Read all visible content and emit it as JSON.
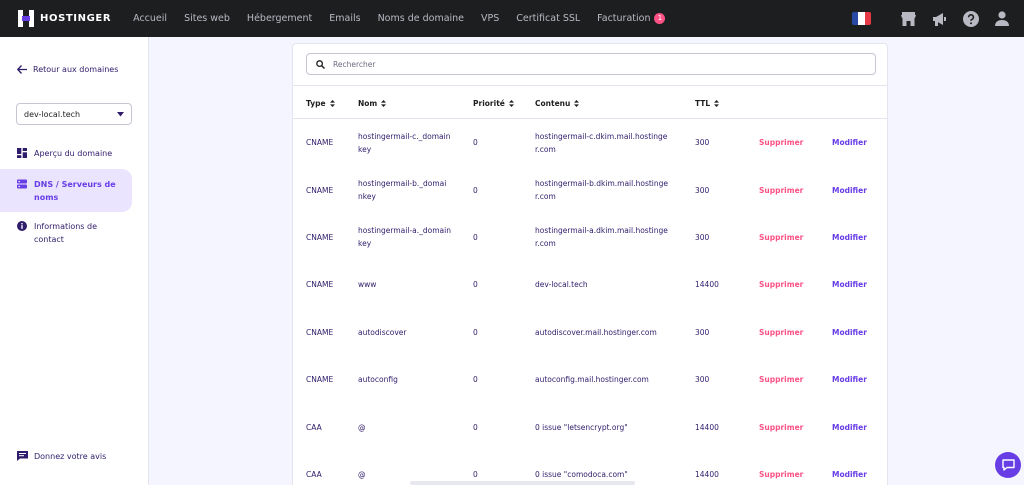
{
  "brand": {
    "name": "HOSTINGER"
  },
  "nav": {
    "items": [
      {
        "label": "Accueil"
      },
      {
        "label": "Sites web"
      },
      {
        "label": "Hébergement"
      },
      {
        "label": "Emails"
      },
      {
        "label": "Noms de domaine"
      },
      {
        "label": "VPS"
      },
      {
        "label": "Certificat SSL"
      },
      {
        "label": "Facturation",
        "badge": "1"
      }
    ]
  },
  "top_icons": [
    "france-flag-icon",
    "store-icon",
    "megaphone-icon",
    "help-icon",
    "user-icon"
  ],
  "sidebar": {
    "back_label": "Retour aux domaines",
    "domain_select": "dev-local.tech",
    "items": [
      {
        "label": "Aperçu du domaine",
        "icon": "dashboard-icon"
      },
      {
        "label": "DNS / Serveurs de noms",
        "icon": "server-icon",
        "active": true
      },
      {
        "label": "Informations de contact",
        "icon": "info-icon"
      }
    ],
    "feedback_label": "Donnez votre avis"
  },
  "search": {
    "placeholder": "Rechercher"
  },
  "table": {
    "headers": [
      "Type",
      "Nom",
      "Priorité",
      "Contenu",
      "TTL"
    ],
    "delete_label": "Supprimer",
    "edit_label": "Modifier",
    "rows": [
      {
        "type": "CNAME",
        "name": "hostingermail-c._domainkey",
        "priority": "0",
        "content": "hostingermail-c.dkim.mail.hostinger.com",
        "ttl": "300"
      },
      {
        "type": "CNAME",
        "name": "hostingermail-b._domainkey",
        "priority": "0",
        "content": "hostingermail-b.dkim.mail.hostinger.com",
        "ttl": "300"
      },
      {
        "type": "CNAME",
        "name": "hostingermail-a._domainkey",
        "priority": "0",
        "content": "hostingermail-a.dkim.mail.hostinger.com",
        "ttl": "300"
      },
      {
        "type": "CNAME",
        "name": "www",
        "priority": "0",
        "content": "dev-local.tech",
        "ttl": "14400"
      },
      {
        "type": "CNAME",
        "name": "autodiscover",
        "priority": "0",
        "content": "autodiscover.mail.hostinger.com",
        "ttl": "300"
      },
      {
        "type": "CNAME",
        "name": "autoconfig",
        "priority": "0",
        "content": "autoconfig.mail.hostinger.com",
        "ttl": "300"
      },
      {
        "type": "CAA",
        "name": "@",
        "priority": "0",
        "content": "0 issue \"letsencrypt.org\"",
        "ttl": "14400"
      },
      {
        "type": "CAA",
        "name": "@",
        "priority": "0",
        "content": "0 issue \"comodoca.com\"",
        "ttl": "14400"
      }
    ]
  },
  "colors": {
    "topbar": "#1d1e20",
    "accent": "#673de6",
    "danger": "#fc5185",
    "text": "#2f1c6a"
  }
}
